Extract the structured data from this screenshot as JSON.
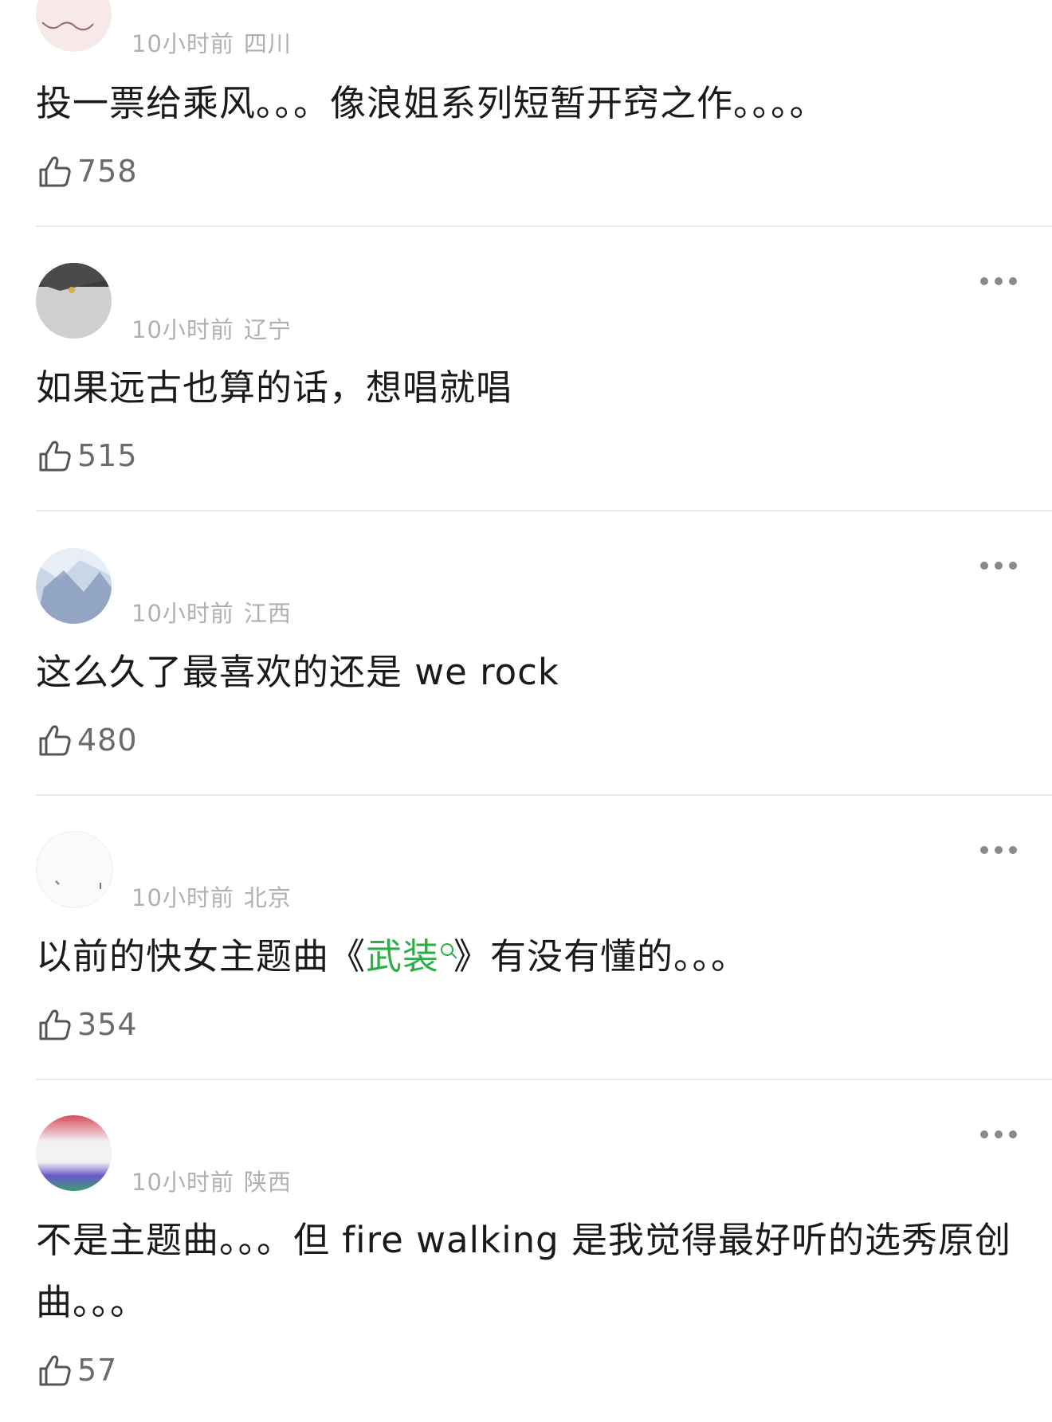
{
  "comments": [
    {
      "time": "10小时前",
      "location": "四川",
      "text": "投一票给乘风。。。像浪姐系列短暂开窍之作。。。。",
      "likes": "758"
    },
    {
      "time": "10小时前",
      "location": "辽宁",
      "text": "如果远古也算的话，想唱就唱",
      "likes": "515"
    },
    {
      "time": "10小时前",
      "location": "江西",
      "text": "这么久了最喜欢的还是 we rock",
      "likes": "480"
    },
    {
      "time": "10小时前",
      "location": "北京",
      "text_before": "以前的快女主题曲《",
      "text_link": "武装",
      "text_after": "》有没有懂的。。。",
      "likes": "354"
    },
    {
      "time": "10小时前",
      "location": "陕西",
      "text": "不是主题曲。。。但 fire walking 是我觉得最好听的选秀原创曲。。。",
      "likes": "57"
    }
  ],
  "colors": {
    "link": "#2bae44",
    "meta": "#b0b0b0",
    "divider": "#e9e9e9"
  },
  "icons": {
    "like": "thumbs-up-icon",
    "more": "more-dots-icon"
  }
}
